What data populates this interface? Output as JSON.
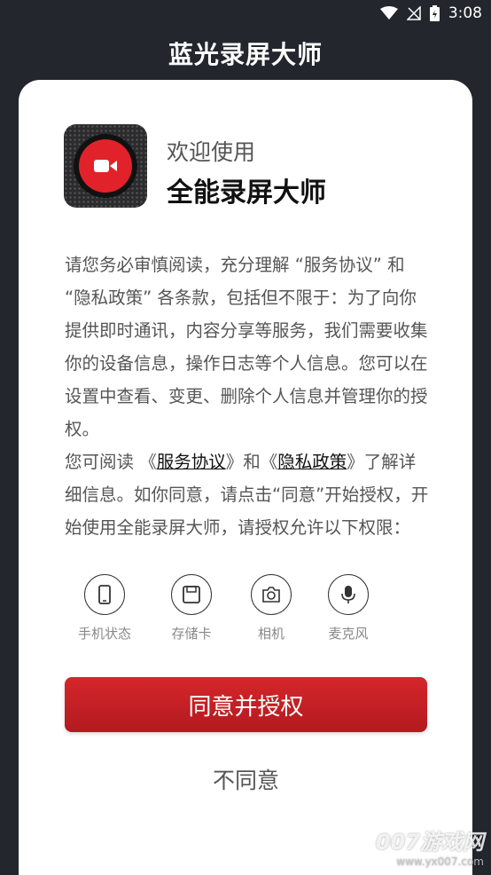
{
  "status_bar": {
    "time": "3:08",
    "icons": [
      "wifi-icon",
      "signal-off-icon",
      "battery-charging-icon"
    ]
  },
  "header": {
    "title": "蓝光录屏大师"
  },
  "dialog": {
    "welcome": "欢迎使用",
    "app_name": "全能录屏大师",
    "paragraph1": "请您务必审慎阅读，充分理解 “服务协议” 和 “隐私政策” 各条款，包括但不限于：为了向你提供即时通讯，内容分享等服务，我们需要收集你的设备信息，操作日志等个人信息。您可以在设置中查看、变更、删除个人信息并管理你的授权。",
    "p2_prefix": "您可阅读 《",
    "terms_link": "服务协议",
    "p2_mid": "》和《",
    "privacy_link": "隐私政策",
    "p2_suffix": "》了解详细信息。如你同意，请点击“同意”开始授权，开始使用全能录屏大师，请授权允许以下权限：",
    "permissions": [
      {
        "label": "手机状态",
        "icon": "phone-icon"
      },
      {
        "label": "存储卡",
        "icon": "sd-card-icon"
      },
      {
        "label": "相机",
        "icon": "camera-icon"
      },
      {
        "label": "麦克风",
        "icon": "microphone-icon"
      }
    ],
    "agree_label": "同意并授权",
    "disagree_label": "不同意"
  },
  "watermark": {
    "main": "007游戏网",
    "url": "www.yx007.com"
  },
  "colors": {
    "background": "#23262d",
    "accent": "#c82026",
    "card": "#ffffff"
  }
}
